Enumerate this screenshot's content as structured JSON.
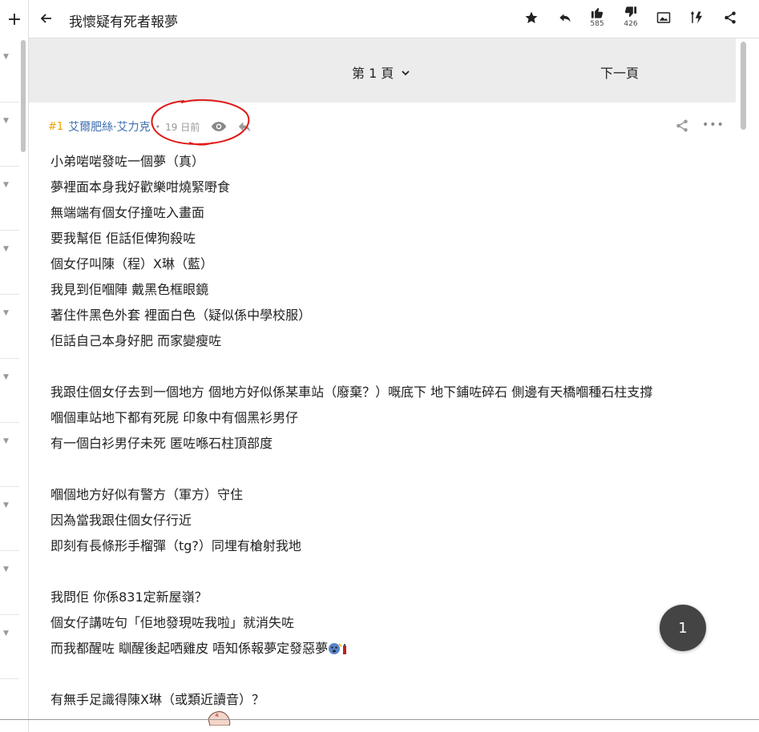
{
  "sidebar": {
    "new_label": "+"
  },
  "header": {
    "title": "我懷疑有死者報夢",
    "like_count": "585",
    "dislike_count": "426"
  },
  "pagebar": {
    "page_label": "第 1 頁",
    "next_label": "下一頁"
  },
  "post": {
    "number": "#1",
    "author": "艾爾肥絲·艾力克",
    "dot": "•",
    "time": "19 日前",
    "more": "•••",
    "lines": [
      "小弟啱啱發咗一個夢（真）",
      "夢裡面本身我好歡樂咁燒緊嘢食",
      "無端端有個女仔撞咗入畫面",
      "要我幫佢 佢話佢俾狗殺咗",
      "個女仔叫陳（程）X琳（藍）",
      "我見到佢嗰陣 戴黑色框眼鏡",
      "著住件黑色外套 裡面白色（疑似係中學校服）",
      "佢話自己本身好肥 而家變瘦咗",
      "",
      "我跟住個女仔去到一個地方 個地方好似係某車站（廢棄？）嘅底下 地下鋪咗碎石 側邊有天橋嗰種石柱支撐",
      "嗰個車站地下都有死屍 印象中有個黑衫男仔",
      "有一個白衫男仔未死 匿咗喺石柱頂部度",
      "",
      "嗰個地方好似有警方（軍方）守住",
      "因為當我跟住個女仔行近",
      "即刻有長條形手榴彈（tg?）同埋有槍射我地",
      "",
      "我問佢 你係831定新屋嶺？",
      "個女仔講咗句「佢地發現咗我啦」就消失咗",
      "而我都醒咗 瞓醒後起哂雞皮 唔知係報夢定發惡夢",
      "",
      "有無手足識得陳X琳（或類近讀音）？"
    ]
  },
  "fab": {
    "label": "1"
  },
  "colors": {
    "accent_number": "#e8a100",
    "author_link": "#3f6fb0",
    "annotation_red": "#e01919",
    "pagebar_bg": "#ececec"
  }
}
